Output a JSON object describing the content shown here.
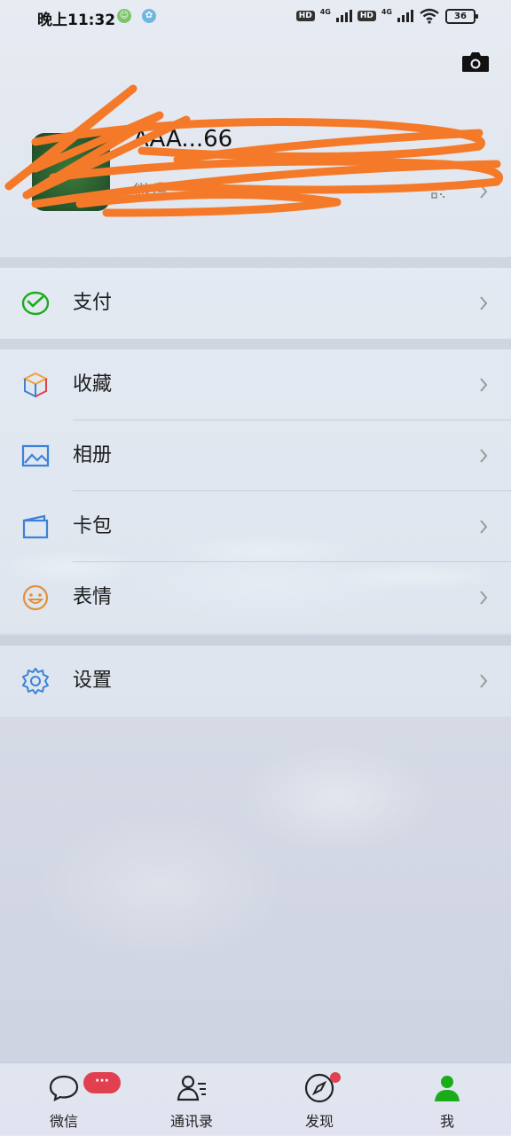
{
  "status_bar": {
    "time": "晚上11:32",
    "hd1": "HD",
    "net1": "4G",
    "hd2": "HD",
    "net2": "4G",
    "battery": "36"
  },
  "profile": {
    "nickname_visible": "AAA...66",
    "wechat_id_label": "微信"
  },
  "menu": {
    "pay": "支付",
    "favorites": "收藏",
    "album": "相册",
    "cards": "卡包",
    "stickers": "表情",
    "settings": "设置"
  },
  "tabs": [
    {
      "label": "微信",
      "badge": "···"
    },
    {
      "label": "通讯录"
    },
    {
      "label": "发现"
    },
    {
      "label": "我"
    }
  ],
  "colors": {
    "accent_green": "#1aad19",
    "badge_red": "#e0404f",
    "redaction_orange": "#f47a2a"
  }
}
